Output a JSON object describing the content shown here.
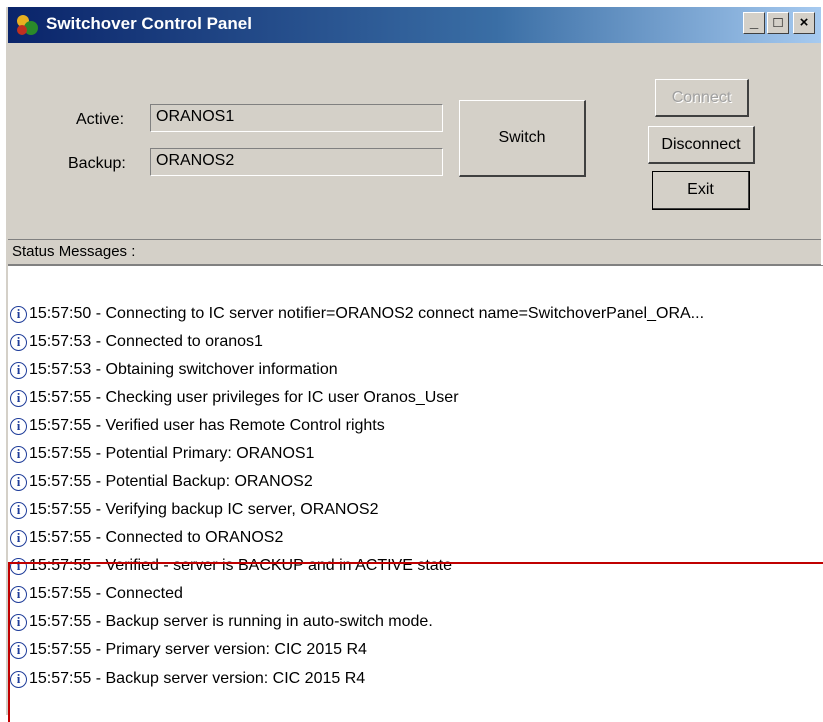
{
  "window": {
    "title": "Switchover Control Panel",
    "controls": {
      "minimize": "_",
      "maximize": "□",
      "close": "×"
    }
  },
  "form": {
    "active_label": "Active:",
    "active_value": "ORANOS1",
    "backup_label": "Backup:",
    "backup_value": "ORANOS2"
  },
  "buttons": {
    "switch": "Switch",
    "connect": "Connect",
    "disconnect": "Disconnect",
    "exit": "Exit"
  },
  "status": {
    "header": "Status Messages :",
    "icon": "info-icon",
    "messages": [
      "15:57:50 - Connecting to IC server notifier=ORANOS2 connect name=SwitchoverPanel_ORA...",
      "15:57:53 - Connected to oranos1",
      "15:57:53 - Obtaining switchover information",
      "15:57:55 - Checking user privileges for IC user Oranos_User",
      "15:57:55 - Verified user has Remote Control rights",
      "15:57:55 - Potential Primary:  ORANOS1",
      "15:57:55 - Potential Backup:  ORANOS2",
      "15:57:55 - Verifying backup IC server, ORANOS2",
      "15:57:55 - Connected to ORANOS2",
      "15:57:55 - Verified - server is BACKUP and in ACTIVE state",
      "15:57:55 - Connected",
      "15:57:55 - Backup server is running in auto-switch mode.",
      "15:57:55 - Primary server version: CIC 2015 R4",
      "15:57:55 - Backup server version: CIC 2015 R4"
    ]
  },
  "colors": {
    "highlight_box": "#c00000",
    "titlebar": "#0a246a",
    "window_face": "#d4d0c8"
  }
}
